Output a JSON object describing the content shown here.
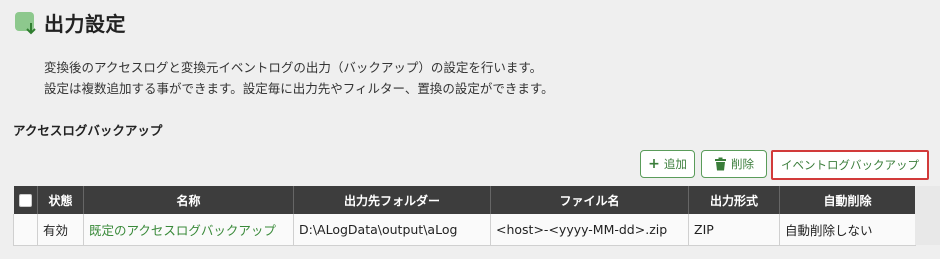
{
  "page": {
    "title": "出力設定",
    "description_line1": "変換後のアクセスログと変換元イベントログの出力（バックアップ）の設定を行います。",
    "description_line2": "設定は複数追加する事ができます。設定毎に出力先やフィルター、置換の設定ができます。"
  },
  "section": {
    "title": "アクセスログバックアップ"
  },
  "toolbar": {
    "add_label": "追加",
    "delete_label": "削除",
    "event_backup_label": "イベントログバックアップ"
  },
  "table": {
    "headers": [
      "状態",
      "名称",
      "出力先フォルダー",
      "ファイル名",
      "出力形式",
      "自動削除"
    ],
    "rows": [
      {
        "status": "有効",
        "name": "既定のアクセスログバックアップ",
        "folder": "D:\\ALogData\\output\\aLog",
        "filename": "<host>-<yyyy-MM-dd>.zip",
        "format": "ZIP",
        "auto_delete": "自動削除しない"
      }
    ]
  },
  "colors": {
    "accent_green": "#3a7d3a",
    "header_bg": "#3d3d3d",
    "highlight_red": "#d23a3a"
  }
}
